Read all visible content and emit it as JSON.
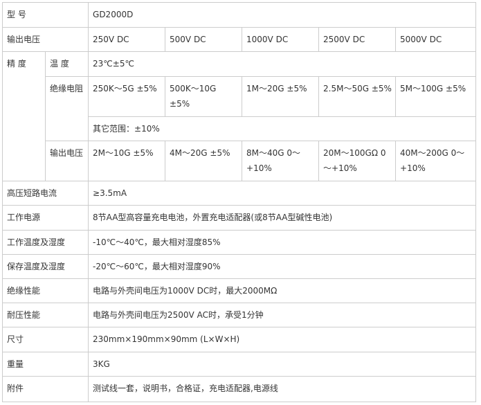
{
  "model": {
    "label": "型 号",
    "value": "GD2000D"
  },
  "output_voltage": {
    "label": "输出电压",
    "values": [
      "250V DC",
      "500V DC",
      "1000V DC",
      "2500V DC",
      "5000V DC"
    ]
  },
  "accuracy": {
    "label": "精 度",
    "temperature": {
      "label": "温 度",
      "value": "23℃±5℃"
    },
    "insulation_resistance": {
      "label": "绝缘电阻",
      "values": [
        "250K～5G ±5%",
        "500K～10G ±5%",
        "1M～20G ±5%",
        "2.5M～50G ±5%",
        "5M～100G ±5%"
      ],
      "other_range": "其它范围：±10%"
    },
    "output_voltage": {
      "label": "输出电压",
      "values": [
        "2M～10G ±5%",
        "4M～20G ±5%",
        "8M～40G 0～+10%",
        "20M～100GΩ 0～+10%",
        "40M～200G 0～+10%"
      ]
    }
  },
  "short_circuit_current": {
    "label": "高压短路电流",
    "value": "≥3.5mA"
  },
  "power_supply": {
    "label": "工作电源",
    "value": "8节AA型高容量充电电池，外置充电适配器(或8节AA型碱性电池)"
  },
  "operating_env": {
    "label": "工作温度及湿度",
    "value": "-10℃～40℃，最大相对湿度85%"
  },
  "storage_env": {
    "label": "保存温度及湿度",
    "value": "-20℃～60℃，最大相对湿度90%"
  },
  "insulation_performance": {
    "label": "绝缘性能",
    "value": "电路与外壳间电压为1000V DC时，最大2000MΩ"
  },
  "withstand_voltage": {
    "label": "耐压性能",
    "value": "电路与外壳间电压为2500V AC时，承受1分钟"
  },
  "dimensions": {
    "label": "尺寸",
    "value": "230mm×190mm×90mm (L×W×H)"
  },
  "weight": {
    "label": "重量",
    "value": "3KG"
  },
  "accessories": {
    "label": "附件",
    "value": "测试线一套，说明书，合格证，充电适配器,电源线"
  }
}
